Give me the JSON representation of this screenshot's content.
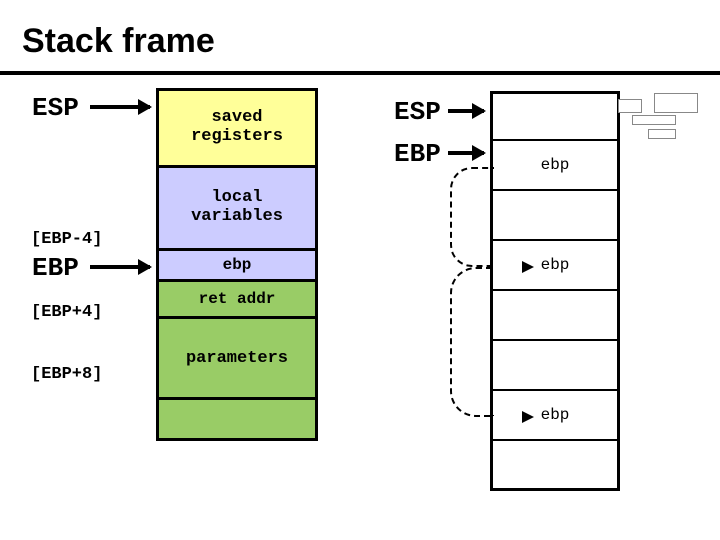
{
  "title": "Stack frame",
  "left": {
    "esp": "ESP",
    "ebp": "EBP",
    "ebp_m4": "[EBP-4]",
    "ebp_p4": "[EBP+4]",
    "ebp_p8": "[EBP+8]",
    "saved": "saved\nregisters",
    "local": "local\nvariables",
    "ebpcell": "ebp",
    "ret": "ret addr",
    "param": "parameters"
  },
  "right": {
    "esp": "ESP",
    "ebp": "EBP",
    "ebp1": "ebp",
    "ebp2": "ebp",
    "ebp3": "ebp"
  }
}
